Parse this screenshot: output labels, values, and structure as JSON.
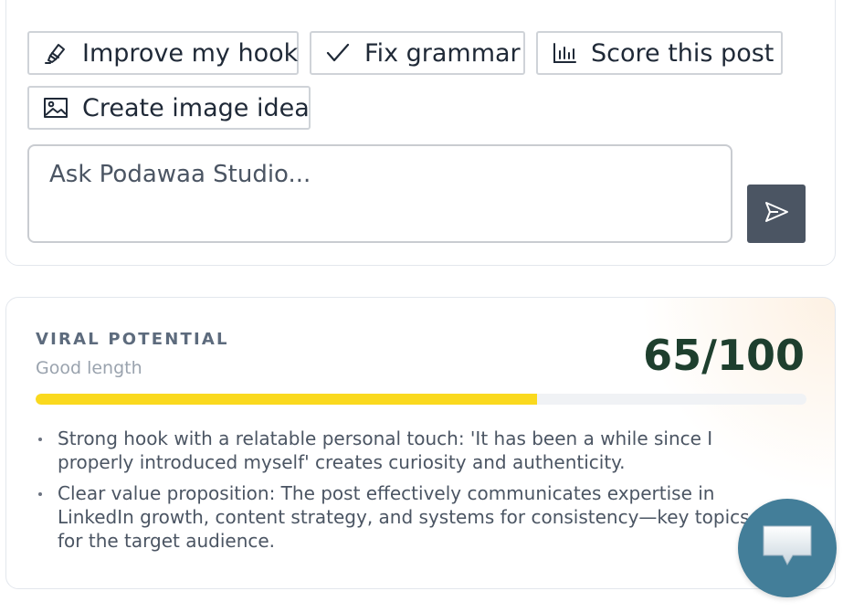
{
  "assistant": {
    "actions": [
      {
        "label": "Improve my hook",
        "icon": "highlighter-icon"
      },
      {
        "label": "Fix grammar",
        "icon": "check-icon"
      },
      {
        "label": "Score this post",
        "icon": "bar-chart-icon"
      },
      {
        "label": "Create image idea",
        "icon": "image-icon"
      }
    ],
    "input_placeholder": "Ask Podawaa Studio...",
    "send_icon": "send-icon"
  },
  "viral": {
    "label": "VIRAL POTENTIAL",
    "subtitle": "Good length",
    "score_text": "65/100",
    "score_value": 65,
    "score_max": 100,
    "bar_color": "#fad91e",
    "points": [
      "Strong hook with a relatable personal touch: 'It has been a while since I properly introduced myself' creates curiosity and authenticity.",
      "Clear value proposition: The post effectively communicates expertise in LinkedIn growth, content strategy, and systems for consistency—key topics for the target audience."
    ]
  },
  "chat_launcher": {
    "icon": "chat-bubble-icon",
    "color": "#437e99"
  }
}
